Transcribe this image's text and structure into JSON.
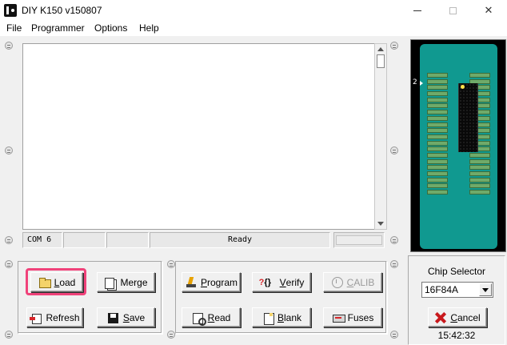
{
  "window": {
    "title": "DIY K150 v150807",
    "controls": {
      "minimize": "—",
      "maximize": "☐",
      "close": "✕"
    }
  },
  "menu": {
    "items": [
      "File",
      "Programmer",
      "Options",
      "Help"
    ]
  },
  "status_bar": {
    "port": "COM 6",
    "cell2": "",
    "cell3": "",
    "message": "Ready",
    "progress": ""
  },
  "chip_view": {
    "pin1_label": "2",
    "pins_per_side": 20,
    "colors": {
      "socket": "#109990",
      "pin": "#6faa6a",
      "chip": "#090909",
      "pin1_dot": "#ffe24a"
    }
  },
  "file_buttons": {
    "load": {
      "prefix": "",
      "mnemonic": "L",
      "rest": "oad"
    },
    "merge": {
      "prefix": "",
      "mnemonic": "",
      "rest": "Merge"
    },
    "refresh": {
      "prefix": "",
      "mnemonic": "",
      "rest": "Refresh"
    },
    "save": {
      "prefix": "",
      "mnemonic": "S",
      "rest": "ave"
    }
  },
  "programmer_buttons": {
    "program": {
      "prefix": "",
      "mnemonic": "P",
      "rest": "rogram"
    },
    "verify": {
      "prefix": "",
      "mnemonic": "V",
      "rest": "erify"
    },
    "calib": {
      "prefix": "",
      "mnemonic": "C",
      "rest": "ALIB",
      "enabled": false
    },
    "read": {
      "prefix": "",
      "mnemonic": "R",
      "rest": "ead"
    },
    "blank": {
      "prefix": "",
      "mnemonic": "B",
      "rest": "lank"
    },
    "fuses": {
      "prefix": "",
      "mnemonic": "",
      "rest": "Fuses"
    }
  },
  "highlight": {
    "target": "load-button",
    "color": "#f0427a"
  },
  "chip_selector": {
    "label": "Chip Selector",
    "selected": "16F84A",
    "cancel": {
      "mnemonic": "C",
      "rest": "ancel"
    },
    "clock": "15:42:32"
  }
}
